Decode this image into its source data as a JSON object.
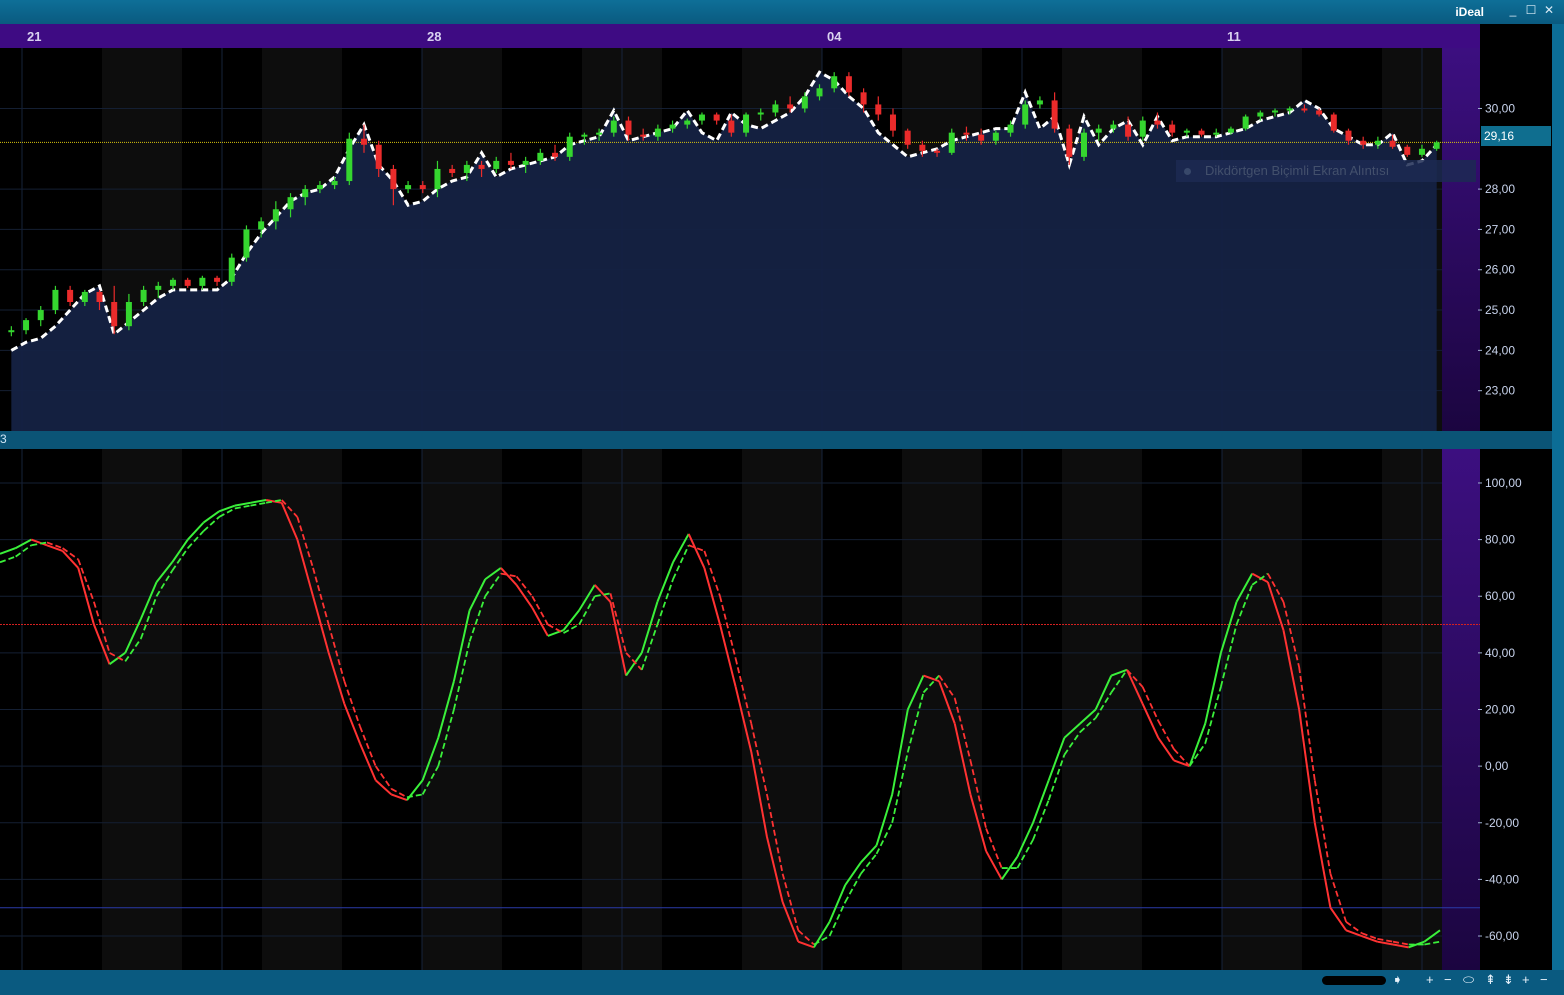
{
  "app": {
    "title": "iDeal",
    "minimize": "_",
    "maximize": "☐",
    "close": "✕"
  },
  "date_axis": {
    "labels": [
      "21",
      "28",
      "04",
      "11"
    ]
  },
  "price_panel": {
    "current_price": "29,16",
    "overlay_text": "Dikdörtgen Biçimli Ekran Alıntısı"
  },
  "indicator_panel": {
    "header_label": "3"
  },
  "nav_bar": {
    "icons": [
      "➧",
      "+",
      "−",
      "⬭",
      "⇞",
      "⇟",
      "+",
      "−"
    ]
  },
  "colors": {
    "up": "#35d62f",
    "down": "#ea2b2b",
    "flat": "#ffd400",
    "trail": "#ffffff",
    "k_up": "#3af03a",
    "k_down": "#ff3232",
    "level_hi": "#d42020",
    "level_lo": "#2a3aa8"
  },
  "chart_data": [
    {
      "type": "candlestick",
      "ylim": [
        22,
        31.5
      ],
      "yticks": [
        "23,00",
        "24,00",
        "25,00",
        "26,00",
        "27,00",
        "28,00",
        "30,00"
      ],
      "ytick_values": [
        23,
        24,
        25,
        26,
        27,
        28,
        30
      ],
      "last_price": 29.16,
      "ohlc": [
        [
          24.45,
          24.6,
          24.35,
          24.5
        ],
        [
          24.5,
          24.8,
          24.4,
          24.75
        ],
        [
          24.75,
          25.1,
          24.6,
          25.0
        ],
        [
          25.0,
          25.6,
          24.9,
          25.5
        ],
        [
          25.5,
          25.6,
          25.1,
          25.2
        ],
        [
          25.2,
          25.5,
          25.1,
          25.45
        ],
        [
          25.45,
          25.5,
          25.0,
          25.2
        ],
        [
          25.2,
          25.6,
          24.4,
          24.6
        ],
        [
          24.6,
          25.4,
          24.5,
          25.2
        ],
        [
          25.2,
          25.6,
          25.1,
          25.5
        ],
        [
          25.5,
          25.7,
          25.3,
          25.6
        ],
        [
          25.6,
          25.8,
          25.5,
          25.75
        ],
        [
          25.75,
          25.8,
          25.55,
          25.6
        ],
        [
          25.6,
          25.85,
          25.5,
          25.8
        ],
        [
          25.8,
          25.85,
          25.6,
          25.7
        ],
        [
          25.7,
          26.4,
          25.6,
          26.3
        ],
        [
          26.3,
          27.1,
          26.2,
          27.0
        ],
        [
          27.0,
          27.3,
          26.8,
          27.2
        ],
        [
          27.2,
          27.7,
          27.0,
          27.5
        ],
        [
          27.5,
          27.9,
          27.3,
          27.8
        ],
        [
          27.8,
          28.1,
          27.6,
          28.0
        ],
        [
          28.0,
          28.2,
          27.9,
          28.1
        ],
        [
          28.1,
          28.3,
          28.0,
          28.2
        ],
        [
          28.2,
          29.4,
          28.1,
          29.25
        ],
        [
          29.25,
          29.6,
          28.9,
          29.1
        ],
        [
          29.1,
          29.2,
          28.3,
          28.5
        ],
        [
          28.5,
          28.6,
          27.6,
          28.0
        ],
        [
          28.0,
          28.2,
          27.9,
          28.1
        ],
        [
          28.1,
          28.2,
          27.9,
          28.0
        ],
        [
          28.0,
          28.7,
          27.8,
          28.5
        ],
        [
          28.5,
          28.6,
          28.3,
          28.4
        ],
        [
          28.4,
          28.7,
          28.2,
          28.6
        ],
        [
          28.6,
          28.7,
          28.3,
          28.5
        ],
        [
          28.5,
          28.8,
          28.4,
          28.7
        ],
        [
          28.7,
          28.9,
          28.5,
          28.6
        ],
        [
          28.6,
          28.8,
          28.4,
          28.7
        ],
        [
          28.7,
          29.0,
          28.6,
          28.9
        ],
        [
          28.9,
          29.1,
          28.7,
          28.8
        ],
        [
          28.8,
          29.4,
          28.7,
          29.3
        ],
        [
          29.3,
          29.4,
          29.1,
          29.35
        ],
        [
          29.35,
          29.5,
          29.2,
          29.4
        ],
        [
          29.4,
          29.8,
          29.3,
          29.7
        ],
        [
          29.7,
          29.8,
          29.2,
          29.35
        ],
        [
          29.35,
          29.5,
          29.2,
          29.3
        ],
        [
          29.3,
          29.6,
          29.2,
          29.5
        ],
        [
          29.5,
          29.7,
          29.4,
          29.6
        ],
        [
          29.6,
          29.75,
          29.5,
          29.7
        ],
        [
          29.7,
          29.9,
          29.6,
          29.85
        ],
        [
          29.85,
          29.9,
          29.6,
          29.7
        ],
        [
          29.7,
          29.85,
          29.3,
          29.4
        ],
        [
          29.4,
          29.9,
          29.3,
          29.85
        ],
        [
          29.85,
          30.0,
          29.7,
          29.9
        ],
        [
          29.9,
          30.2,
          29.8,
          30.1
        ],
        [
          30.1,
          30.3,
          29.9,
          30.0
        ],
        [
          30.0,
          30.4,
          29.9,
          30.3
        ],
        [
          30.3,
          30.6,
          30.2,
          30.5
        ],
        [
          30.5,
          30.9,
          30.4,
          30.8
        ],
        [
          30.8,
          30.9,
          30.3,
          30.4
        ],
        [
          30.4,
          30.5,
          29.9,
          30.1
        ],
        [
          30.1,
          30.3,
          29.7,
          29.85
        ],
        [
          29.85,
          30.0,
          29.3,
          29.45
        ],
        [
          29.45,
          29.5,
          29.0,
          29.1
        ],
        [
          29.1,
          29.2,
          28.8,
          28.95
        ],
        [
          28.95,
          29.0,
          28.8,
          28.9
        ],
        [
          28.9,
          29.5,
          28.85,
          29.4
        ],
        [
          29.4,
          29.55,
          29.2,
          29.35
        ],
        [
          29.35,
          29.5,
          29.1,
          29.2
        ],
        [
          29.2,
          29.45,
          29.1,
          29.4
        ],
        [
          29.4,
          29.7,
          29.3,
          29.6
        ],
        [
          29.6,
          30.2,
          29.5,
          30.1
        ],
        [
          30.1,
          30.3,
          30.0,
          30.2
        ],
        [
          30.2,
          30.4,
          29.4,
          29.5
        ],
        [
          29.5,
          29.6,
          28.6,
          28.8
        ],
        [
          28.8,
          29.5,
          28.7,
          29.4
        ],
        [
          29.4,
          29.6,
          29.2,
          29.5
        ],
        [
          29.5,
          29.7,
          29.4,
          29.6
        ],
        [
          29.6,
          29.8,
          29.2,
          29.3
        ],
        [
          29.3,
          29.8,
          29.2,
          29.7
        ],
        [
          29.7,
          29.9,
          29.5,
          29.6
        ],
        [
          29.6,
          29.7,
          29.3,
          29.4
        ],
        [
          29.4,
          29.5,
          29.3,
          29.45
        ],
        [
          29.45,
          29.5,
          29.3,
          29.35
        ],
        [
          29.35,
          29.5,
          29.3,
          29.4
        ],
        [
          29.4,
          29.55,
          29.35,
          29.5
        ],
        [
          29.5,
          29.85,
          29.45,
          29.8
        ],
        [
          29.8,
          29.95,
          29.7,
          29.9
        ],
        [
          29.9,
          30.0,
          29.8,
          29.95
        ],
        [
          29.95,
          30.05,
          29.85,
          30.0
        ],
        [
          30.0,
          30.1,
          29.9,
          29.95
        ],
        [
          29.95,
          30.0,
          29.8,
          29.85
        ],
        [
          29.85,
          29.9,
          29.4,
          29.45
        ],
        [
          29.45,
          29.5,
          29.1,
          29.2
        ],
        [
          29.2,
          29.3,
          29.0,
          29.1
        ],
        [
          29.1,
          29.3,
          29.0,
          29.2
        ],
        [
          29.2,
          29.35,
          29.0,
          29.05
        ],
        [
          29.05,
          29.1,
          28.8,
          28.85
        ],
        [
          28.85,
          29.1,
          28.8,
          29.0
        ],
        [
          29.0,
          29.2,
          28.95,
          29.16
        ]
      ],
      "trail": [
        24.0,
        24.2,
        24.3,
        24.6,
        25.0,
        25.4,
        25.6,
        24.4,
        24.7,
        25.0,
        25.3,
        25.5,
        25.5,
        25.5,
        25.5,
        25.8,
        26.4,
        26.9,
        27.3,
        27.7,
        27.9,
        28.0,
        28.3,
        29.0,
        29.6,
        28.6,
        28.2,
        27.6,
        27.7,
        28.0,
        28.2,
        28.3,
        28.9,
        28.3,
        28.5,
        28.6,
        28.7,
        28.8,
        29.1,
        29.2,
        29.3,
        29.95,
        29.2,
        29.3,
        29.4,
        29.5,
        29.95,
        29.4,
        29.2,
        29.9,
        29.6,
        29.5,
        29.7,
        29.9,
        30.3,
        30.9,
        30.7,
        30.3,
        30.0,
        29.4,
        29.1,
        28.8,
        28.9,
        29.0,
        29.2,
        29.3,
        29.4,
        29.5,
        29.5,
        30.4,
        29.5,
        29.8,
        28.6,
        29.8,
        29.1,
        29.5,
        29.7,
        29.1,
        29.8,
        29.2,
        29.3,
        29.3,
        29.3,
        29.4,
        29.5,
        29.7,
        29.8,
        29.9,
        30.2,
        30.0,
        29.5,
        29.3,
        29.1,
        29.1,
        29.4,
        28.6,
        28.7,
        29.1
      ]
    },
    {
      "type": "line",
      "ylim": [
        -72,
        112
      ],
      "yticks": [
        "100,00",
        "80,00",
        "60,00",
        "40,00",
        "20,00",
        "0,00",
        "-20,00",
        "-40,00",
        "-60,00"
      ],
      "ytick_values": [
        100,
        80,
        60,
        40,
        20,
        0,
        -20,
        -40,
        -60
      ],
      "levels": [
        50,
        -50
      ],
      "series": [
        {
          "style": "solid",
          "values": [
            75,
            77,
            80,
            78,
            76,
            70,
            50,
            36,
            40,
            52,
            65,
            72,
            80,
            86,
            90,
            92,
            93,
            94,
            93,
            80,
            60,
            40,
            22,
            8,
            -5,
            -10,
            -12,
            -5,
            10,
            30,
            55,
            66,
            70,
            64,
            56,
            46,
            48,
            55,
            64,
            58,
            32,
            40,
            58,
            72,
            82,
            70,
            50,
            28,
            5,
            -25,
            -48,
            -62,
            -64,
            -55,
            -42,
            -34,
            -28,
            -10,
            20,
            32,
            30,
            15,
            -10,
            -30,
            -40,
            -32,
            -20,
            -5,
            10,
            15,
            20,
            32,
            34,
            22,
            10,
            2,
            0,
            15,
            40,
            58,
            68,
            65,
            48,
            20,
            -20,
            -50,
            -58,
            -60,
            -62,
            -63,
            -64,
            -62,
            -58
          ]
        },
        {
          "style": "dashed",
          "values": [
            72,
            74,
            78,
            79,
            77,
            73,
            58,
            40,
            37,
            45,
            60,
            69,
            77,
            83,
            88,
            91,
            92,
            93,
            94,
            88,
            70,
            50,
            30,
            14,
            0,
            -8,
            -11,
            -10,
            0,
            20,
            44,
            60,
            68,
            67,
            60,
            50,
            47,
            50,
            60,
            61,
            40,
            34,
            50,
            66,
            78,
            76,
            60,
            38,
            15,
            -10,
            -38,
            -58,
            -63,
            -60,
            -48,
            -38,
            -31,
            -20,
            5,
            26,
            32,
            24,
            2,
            -22,
            -36,
            -36,
            -26,
            -12,
            4,
            12,
            17,
            26,
            34,
            28,
            16,
            6,
            0,
            8,
            28,
            50,
            64,
            68,
            58,
            35,
            -5,
            -38,
            -55,
            -59,
            -61,
            -62,
            -63,
            -63,
            -62
          ]
        }
      ]
    }
  ]
}
